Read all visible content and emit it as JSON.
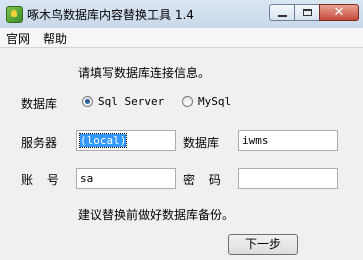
{
  "window": {
    "title": "啄木鸟数据库内容替换工具 1.4"
  },
  "menu": {
    "items": [
      "官网",
      "帮助"
    ]
  },
  "form": {
    "instruction": "请填写数据库连接信息。",
    "db_type_label": "数据库",
    "db_options": [
      "Sql Server",
      "MySql"
    ],
    "selected_db": "Sql Server",
    "server_label": "服务器",
    "server_value": "(local)",
    "database_label": "数据库",
    "database_value": "iwms",
    "account_label": "账  号",
    "account_value": "sa",
    "password_label": "密  码",
    "password_value": "",
    "advice": "建议替换前做好数据库备份。",
    "next_button": "下一步"
  }
}
